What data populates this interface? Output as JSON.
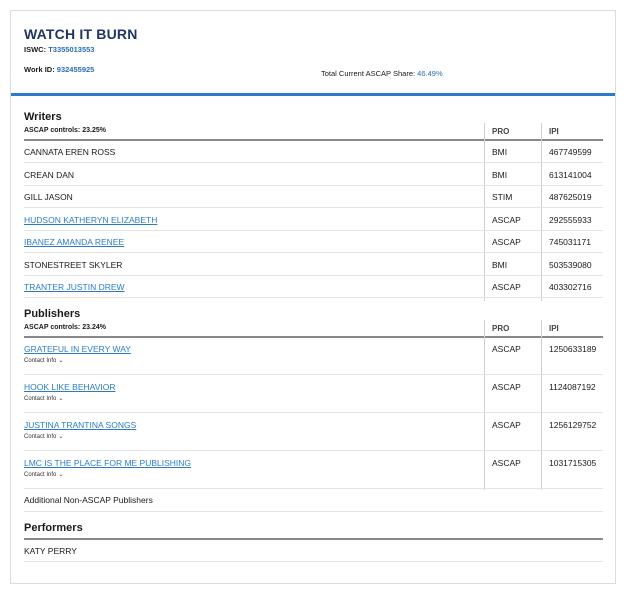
{
  "work": {
    "title": "WATCH IT BURN",
    "iswc_label": "ISWC:",
    "iswc": "T3355013553",
    "work_id_label": "Work ID:",
    "work_id": "932455925",
    "share_label": "Total Current ASCAP Share:",
    "share": "46.49%"
  },
  "writers": {
    "heading": "Writers",
    "controls": "ASCAP controls: 23.25%",
    "col_pro": "PRO",
    "col_ipi": "IPI",
    "rows": [
      {
        "name": "CANNATA EREN ROSS",
        "pro": "BMI",
        "ipi": "467749599"
      },
      {
        "name": "CREAN DAN",
        "pro": "BMI",
        "ipi": "613141004"
      },
      {
        "name": "GILL JASON",
        "pro": "STIM",
        "ipi": "487625019"
      },
      {
        "name": "HUDSON KATHERYN ELIZABETH",
        "pro": "ASCAP",
        "ipi": "292555933"
      },
      {
        "name": "IBANEZ AMANDA RENEE",
        "pro": "ASCAP",
        "ipi": "745031171"
      },
      {
        "name": "STONESTREET SKYLER",
        "pro": "BMI",
        "ipi": "503539080"
      },
      {
        "name": "TRANTER JUSTIN DREW",
        "pro": "ASCAP",
        "ipi": "403302716"
      }
    ]
  },
  "publishers": {
    "heading": "Publishers",
    "controls": "ASCAP controls: 23.24%",
    "col_pro": "PRO",
    "col_ipi": "IPI",
    "contact_label": "Contact Info",
    "rows": [
      {
        "name": "GRATEFUL IN EVERY WAY",
        "pro": "ASCAP",
        "ipi": "1250633189"
      },
      {
        "name": "HOOK LIKE BEHAVIOR",
        "pro": "ASCAP",
        "ipi": "1124087192"
      },
      {
        "name": "JUSTINA TRANTINA SONGS",
        "pro": "ASCAP",
        "ipi": "1256129752"
      },
      {
        "name": "LMC IS THE PLACE FOR ME PUBLISHING",
        "pro": "ASCAP",
        "ipi": "1031715305"
      }
    ],
    "additional": "Additional Non-ASCAP Publishers"
  },
  "performers": {
    "heading": "Performers",
    "rows": [
      "KATY PERRY"
    ]
  },
  "colors": {
    "title": "#1f3563",
    "link": "#2a7cc7",
    "accent_bar": "#2a7cc7"
  }
}
